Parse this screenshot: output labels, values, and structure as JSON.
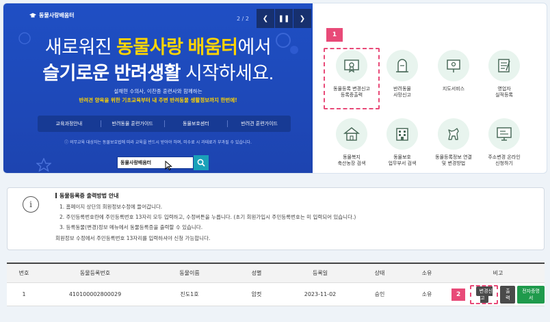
{
  "banner": {
    "logo_text": "동물사랑배움터",
    "page_indicator": "2 / 2",
    "headline1_pre": "새로워진 ",
    "headline1_highlight": "동물사랑 배움터",
    "headline1_post": "에서",
    "headline2_bold": "슬기로운 반려생활",
    "headline2_post": " 시작하세요.",
    "subtitle1": "설채현 수의사, 이찬종 훈련사와 함께하는",
    "subtitle2": "반려견 양육을 위한 기초교육부터 내 주변 반려동물 생활정보까지 한번에!",
    "nav": [
      "교육과정안내",
      "반려동물 훈련가이드",
      "동물보호센터",
      "반려견 훈련가이드"
    ],
    "note": "ⓘ 의무교육 대상자는 동물보호법에 따라 교육을 반드시 받아야 하며, 미수료 시 과태료가 부과될 수 있습니다.",
    "search_value": "동물사랑배움터"
  },
  "services": {
    "highlight_badge": "1",
    "items": [
      {
        "label1": "동물등록 변경신고",
        "label2": "등록증출력"
      },
      {
        "label1": "반려동물",
        "label2": "사망신고"
      },
      {
        "label1": "지도서비스",
        "label2": ""
      },
      {
        "label1": "영업자",
        "label2": "실적등록"
      },
      {
        "label1": "동물복지",
        "label2": "축산농장 검색"
      },
      {
        "label1": "동물보호",
        "label2": "업무부서 검색"
      },
      {
        "label1": "동물등록정보 연결",
        "label2": "및 변경방법"
      },
      {
        "label1": "주소변경 온라인",
        "label2": "신청하기"
      }
    ]
  },
  "info": {
    "icon": "i",
    "title": "동물등록증 출력방법 안내",
    "lines": [
      "1. 홈페이지 상단의 회원정보수정에 들어갑니다.",
      "2. 주민등록번호란에 주민등록번호 13자리 모두 입력하고, 수정버튼을 누릅니다. (초기 회원가입시 주민등록번호는 미 입력되어 있습니다.)",
      "3. 등록동물(변경)정보 메뉴에서 동물등록증을 출력할 수 있습니다.",
      "회원정보 수정에서 주민등록번호 13자리를 입력하셔야 신청 가능합니다."
    ]
  },
  "table": {
    "headers": [
      "번호",
      "동물등록번호",
      "동물이름",
      "성별",
      "등록일",
      "상태",
      "소유",
      "비고"
    ],
    "row": {
      "no": "1",
      "reg_no": "410100002800029",
      "name": "진도1호",
      "sex": "암컷",
      "date": "2023-11-02",
      "status": "승인",
      "owner": "소유",
      "badge": "2",
      "btn_change": "변경신고",
      "btn_print": "출력",
      "btn_ecert": "전자증명서"
    }
  },
  "colors": {
    "banner_bg": "#1f4fc4",
    "highlight": "#ffd400",
    "accent_pink": "#e84a78",
    "green": "#1f9a4c"
  }
}
